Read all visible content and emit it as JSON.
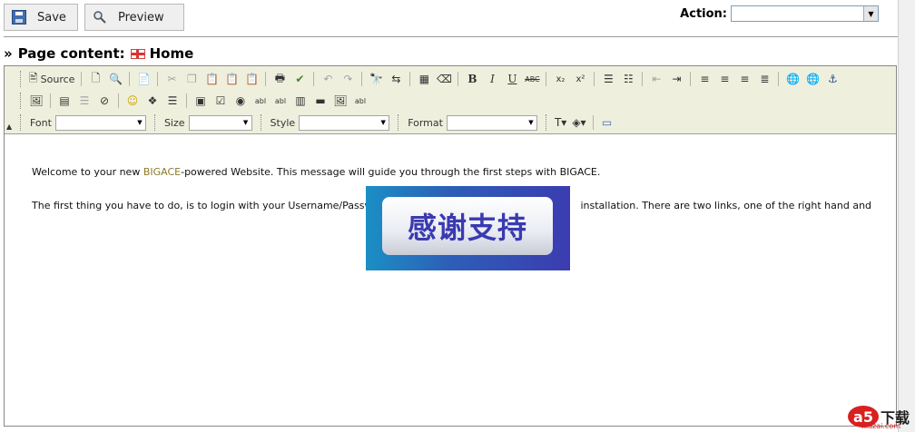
{
  "toolbar": {
    "save_label": "Save",
    "preview_label": "Preview",
    "action_label": "Action:",
    "action_value": ""
  },
  "page": {
    "title_prefix": "»",
    "title_label": "Page content:",
    "page_name": "Home"
  },
  "editor": {
    "source_label": "Source",
    "font_label": "Font",
    "size_label": "Size",
    "style_label": "Style",
    "format_label": "Format",
    "font_value": "",
    "size_value": "",
    "style_value": "",
    "format_value": ""
  },
  "content": {
    "p1_before": "Welcome to your new ",
    "p1_brand": "BIGACE",
    "p1_after": "-powered Website. This message will guide you through the first steps with BIGACE.",
    "p2_left": "The first thing you have to do, is to login with your Username/Passw",
    "p2_right": "installation. There are two links, one of the right hand and"
  },
  "overlay": {
    "text": "感谢支持"
  },
  "watermark": {
    "logo": "a5",
    "chinese": "下载",
    "domain": "xiazai.com"
  }
}
